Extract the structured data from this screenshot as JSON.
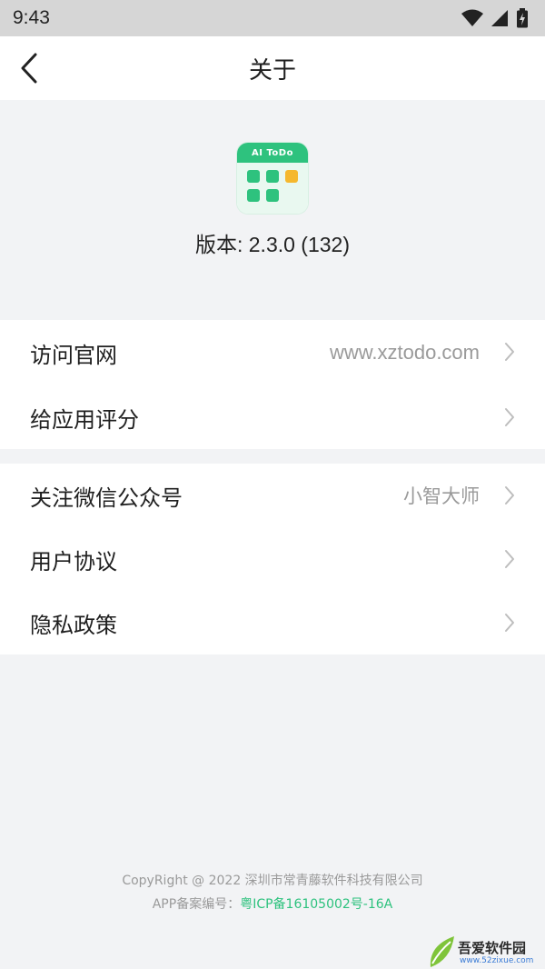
{
  "status_bar": {
    "time": "9:43"
  },
  "navbar": {
    "title": "关于"
  },
  "app": {
    "logo_text": "AI ToDo",
    "version_text": "版本: 2.3.0 (132)"
  },
  "menu_group_1": [
    {
      "label": "访问官网",
      "value": "www.xztodo.com"
    },
    {
      "label": "给应用评分",
      "value": ""
    }
  ],
  "menu_group_2": [
    {
      "label": "关注微信公众号",
      "value": "小智大师"
    },
    {
      "label": "用户协议",
      "value": ""
    },
    {
      "label": "隐私政策",
      "value": ""
    }
  ],
  "footer": {
    "copyright": "CopyRight @ 2022 深圳市常青藤软件科技有限公司",
    "icp_prefix": "APP备案编号：",
    "icp_number": "粤ICP备16105002号-16A"
  },
  "watermark": {
    "text": "吾爱软件园",
    "url": "www.52zixue.com"
  },
  "colors": {
    "accent": "#2ec27e",
    "status_bar": "#d6d6d6",
    "page_bg": "#f2f3f5"
  }
}
